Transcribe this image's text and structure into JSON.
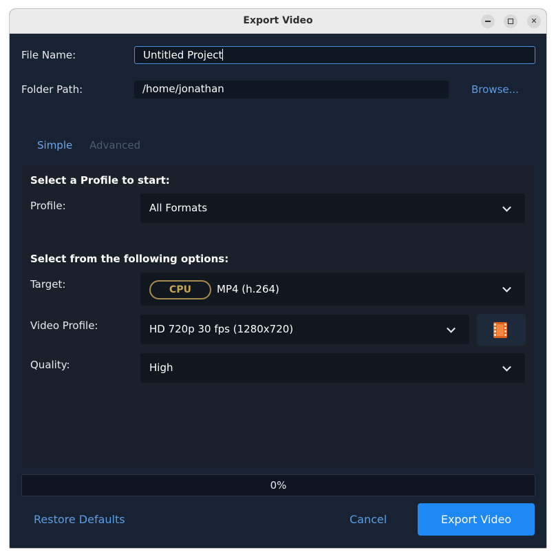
{
  "window": {
    "title": "Export Video"
  },
  "form": {
    "file_name_label": "File Name:",
    "file_name_value": "Untitled Project",
    "folder_path_label": "Folder Path:",
    "folder_path_value": "/home/jonathan",
    "browse_label": "Browse..."
  },
  "tabs": [
    {
      "label": "Simple",
      "active": true
    },
    {
      "label": "Advanced",
      "active": false
    }
  ],
  "simple": {
    "profile_heading": "Select a Profile to start:",
    "profile_label": "Profile:",
    "profile_value": "All Formats",
    "options_heading": "Select from the following options:",
    "target_label": "Target:",
    "target_badge": "CPU",
    "target_value": "MP4 (h.264)",
    "video_profile_label": "Video Profile:",
    "video_profile_value": "HD 720p 30 fps (1280x720)",
    "quality_label": "Quality:",
    "quality_value": "High"
  },
  "progress": {
    "value": 0,
    "text": "0%"
  },
  "footer": {
    "restore_label": "Restore Defaults",
    "cancel_label": "Cancel",
    "export_label": "Export Video"
  },
  "colors": {
    "accent": "#1e88f5",
    "link": "#5d9de6",
    "background": "#172232",
    "badge": "#c9a654"
  },
  "icons": [
    "minimize-icon",
    "maximize-icon",
    "close-icon",
    "chevron-down-icon",
    "film-icon"
  ]
}
